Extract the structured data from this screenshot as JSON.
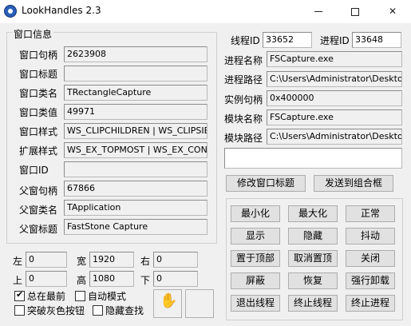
{
  "window": {
    "title": "LookHandles 2.3"
  },
  "group": {
    "title": "窗口信息"
  },
  "window_info": [
    {
      "label": "窗口句柄",
      "value": "2623908"
    },
    {
      "label": "窗口标题",
      "value": ""
    },
    {
      "label": "窗口类名",
      "value": "TRectangleCapture"
    },
    {
      "label": "窗口类值",
      "value": "49971"
    },
    {
      "label": "窗口样式",
      "value": "WS_CLIPCHILDREN | WS_CLIPSIBLI"
    },
    {
      "label": "扩展样式",
      "value": "WS_EX_TOPMOST | WS_EX_CONTR"
    },
    {
      "label": "窗口ID",
      "value": ""
    },
    {
      "label": "父窗句柄",
      "value": "67866"
    },
    {
      "label": "父窗类名",
      "value": "TApplication"
    },
    {
      "label": "父窗标题",
      "value": "FastStone Capture"
    }
  ],
  "rect": {
    "left_label": "左",
    "left_value": "0",
    "width_label": "宽",
    "width_value": "1920",
    "right_label": "右",
    "right_value": "0",
    "top_label": "上",
    "top_value": "0",
    "height_label": "高",
    "height_value": "1080",
    "bottom_label": "下",
    "bottom_value": "0"
  },
  "options": {
    "always_on_top": {
      "label": "总在最前",
      "checked": true
    },
    "auto_mode": {
      "label": "自动模式",
      "checked": false
    },
    "break_gray": {
      "label": "突破灰色按钮",
      "checked": false
    },
    "hidden_search": {
      "label": "隐藏查找",
      "checked": false
    }
  },
  "process": {
    "thread_id_label": "线程ID",
    "thread_id": "33652",
    "process_id_label": "进程ID",
    "process_id": "33648",
    "name_label": "进程名称",
    "name": "FSCapture.exe",
    "path_label": "进程路径",
    "path": "C:\\Users\\Administrator\\Desktop\\",
    "instance_label": "实例句柄",
    "instance": "0x400000",
    "module_name_label": "模块名称",
    "module_name": "FSCapture.exe",
    "module_path_label": "模块路径",
    "module_path": "C:\\Users\\Administrator\\Desktop\\"
  },
  "actions": {
    "modify_title": "修改窗口标题",
    "send_to_combo": "发送到组合框",
    "grid": [
      [
        "最小化",
        "最大化",
        "正常"
      ],
      [
        "显示",
        "隐藏",
        "抖动"
      ],
      [
        "置于顶部",
        "取消置顶",
        "关闭"
      ],
      [
        "屏蔽",
        "恢复",
        "强行卸载"
      ],
      [
        "退出线程",
        "终止线程",
        "终止进程"
      ]
    ]
  }
}
